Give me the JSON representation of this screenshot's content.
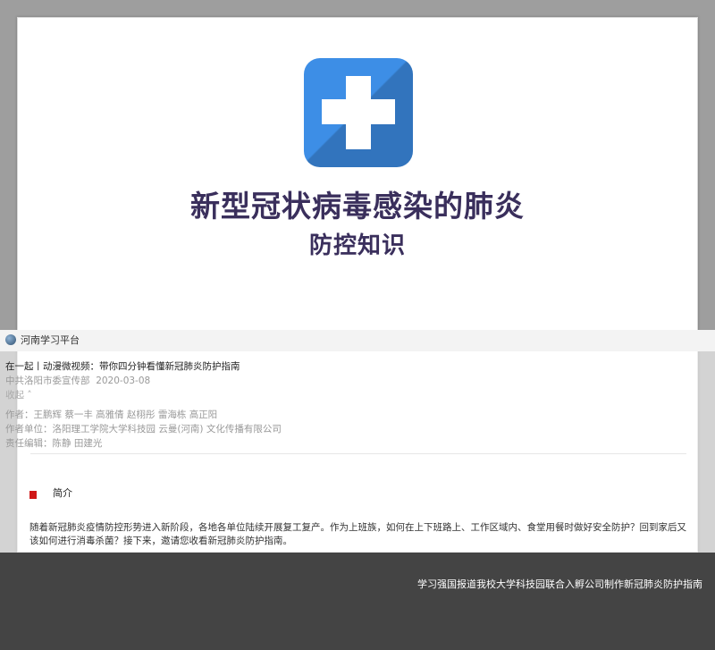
{
  "cover": {
    "title_line1": "新型冠状病毒感染的肺炎",
    "title_line2": "防控知识",
    "icon": "medical-cross-icon",
    "icon_color": "#3d8ee6"
  },
  "source": {
    "name": "河南学习平台"
  },
  "article": {
    "headline": "在一起丨动漫微视频：带你四分钟看懂新冠肺炎防护指南",
    "publisher": "中共洛阳市委宣传部",
    "date": "2020-03-08",
    "collapse": "收起",
    "authors_label": "作者：",
    "authors": "王鹏辉 蔡一丰 高雅倩 赵栩彤 雷海栋 高正阳",
    "org_label": "作者单位：",
    "org": "洛阳理工学院大学科技园 云曼(河南) 文化传播有限公司",
    "editor_label": "责任编辑：",
    "editor": "陈静 田建光"
  },
  "section": {
    "title": "简介",
    "accent_color": "#d01818"
  },
  "summary": "随着新冠肺炎疫情防控形势进入新阶段，各地各单位陆续开展复工复产。作为上班族，如何在上下班路上、工作区域内、食堂用餐时做好安全防护？回到家后又该如何进行消毒杀菌？接下来，邀请您收看新冠肺炎防护指南。",
  "footer": {
    "caption": "学习强国报道我校大学科技园联合入孵公司制作新冠肺炎防护指南"
  }
}
